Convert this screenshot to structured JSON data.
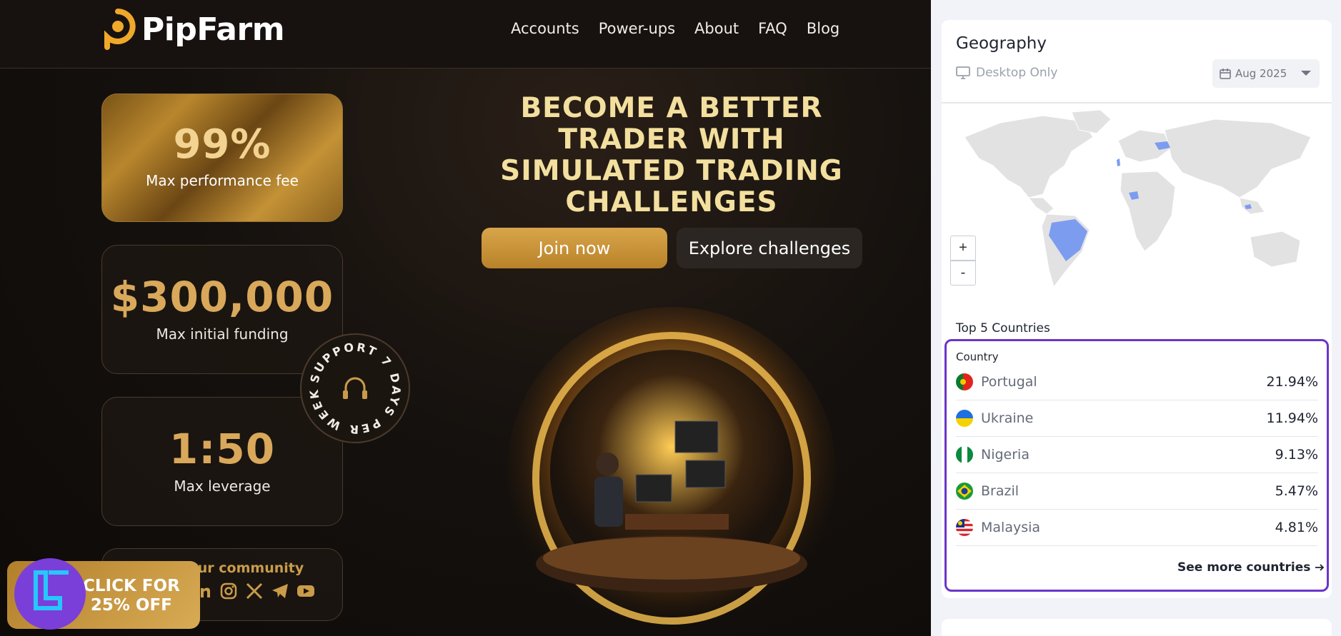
{
  "site": {
    "brand": "PipFarm",
    "nav": [
      "Accounts",
      "Power-ups",
      "About",
      "FAQ",
      "Blog"
    ],
    "hero": {
      "title_lines": [
        "BECOME A BETTER",
        "TRADER WITH",
        "SIMULATED TRADING",
        "CHALLENGES"
      ],
      "join_label": "Join now",
      "explore_label": "Explore challenges"
    },
    "stats": [
      {
        "value": "99%",
        "label": "Max performance fee"
      },
      {
        "value": "$300,000",
        "label": "Max initial funding"
      },
      {
        "value": "1:50",
        "label": "Max leverage"
      }
    ],
    "community": {
      "label": "ur community"
    },
    "support_badge": {
      "text": "SUPPORT 7 DAYS PER WEEK"
    },
    "social_icons": [
      "linkedin-icon",
      "instagram-icon",
      "x-icon",
      "telegram-icon",
      "youtube-icon"
    ],
    "promo": {
      "line1": "CLICK FOR",
      "line2": "25% OFF"
    }
  },
  "geography": {
    "title": "Geography",
    "device_label": "Desktop Only",
    "date_label": "Aug 2025",
    "zoom_in": "+",
    "zoom_out": "-",
    "top_label": "Top 5 Countries",
    "column_header": "Country",
    "countries": [
      {
        "name": "Portugal",
        "share": "21.94%"
      },
      {
        "name": "Ukraine",
        "share": "11.94%"
      },
      {
        "name": "Nigeria",
        "share": "9.13%"
      },
      {
        "name": "Brazil",
        "share": "5.47%"
      },
      {
        "name": "Malaysia",
        "share": "4.81%"
      }
    ],
    "see_more": "See more countries",
    "colors": {
      "highlight": "#6b35c9",
      "map_active": "#7c9cf0",
      "map_base": "#e2e2e2"
    }
  }
}
